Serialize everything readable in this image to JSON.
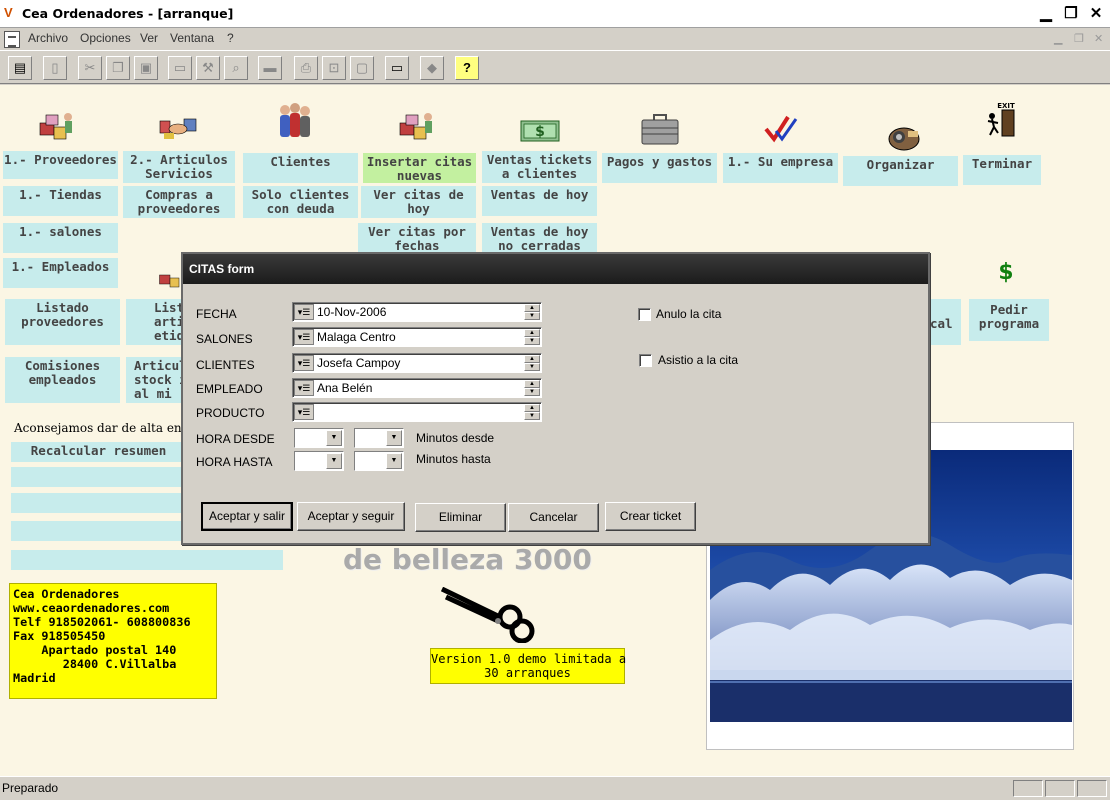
{
  "window": {
    "title": "Cea Ordenadores  - [arranque]",
    "minimize": "▁",
    "restore": "❐",
    "close": "✕"
  },
  "menu": {
    "items": [
      "Archivo",
      "Opciones",
      "Ver",
      "Ventana",
      "?"
    ],
    "mdi_controls": [
      "▁",
      "❐",
      "✕"
    ]
  },
  "toolbar": {
    "buttons": [
      {
        "name": "open-folder-icon",
        "glyph": "▤"
      },
      {
        "name": "new-document-icon",
        "glyph": "▯"
      },
      {
        "name": "cut-icon",
        "glyph": "✂"
      },
      {
        "name": "copy-icon",
        "glyph": "❐"
      },
      {
        "name": "paste-icon",
        "glyph": "▣"
      },
      {
        "name": "window-icon",
        "glyph": "▭"
      },
      {
        "name": "tools-icon",
        "glyph": "⚒"
      },
      {
        "name": "find-icon",
        "glyph": "⌕"
      },
      {
        "name": "eraser-icon",
        "glyph": "▬"
      },
      {
        "name": "print-icon",
        "glyph": "⎙"
      },
      {
        "name": "print-preview-icon",
        "glyph": "⊡"
      },
      {
        "name": "page-setup-icon",
        "glyph": "▢"
      },
      {
        "name": "monitor-icon",
        "glyph": "▭"
      },
      {
        "name": "label-icon",
        "glyph": "◆"
      },
      {
        "name": "help-icon",
        "glyph": "?"
      }
    ]
  },
  "main": {
    "buttons": {
      "proveedores": "1.- Proveedores",
      "articulos_servicios": "2.- Articulos\nServicios",
      "clientes": "Clientes",
      "insertar_citas": "Insertar citas\nnuevas",
      "ventas_tickets": "Ventas tickets\na clientes",
      "pagos_gastos": "Pagos y gastos",
      "su_empresa": "1.- Su empresa",
      "organizar": "Organizar",
      "terminar": "Terminar",
      "tiendas": "1.- Tiendas",
      "compras": "Compras a\nproveedores",
      "solo_clientes_deuda": "Solo clientes\ncon deuda",
      "ver_citas_hoy": "Ver citas de\nhoy",
      "ventas_hoy": "Ventas de hoy",
      "salones": "1.- salones",
      "ver_citas_fechas": "Ver citas por\nfechas",
      "ventas_no_cerradas": "Ventas de hoy\nno cerradas",
      "empleados": "1.- Empleados",
      "listado_proveedores": "Listado\nproveedores",
      "listado_articulos": "List\nartic\netiqu",
      "pedir_programa": "Pedir\nprograma",
      "partial_right": "cal",
      "comisiones": "Comisiones\nempleados",
      "articulos_stock": "Articul\nstock i\nal mi",
      "recalcular": "Recalcular resumen"
    },
    "info_text": "Aconsejamos dar de alta en e",
    "belleza": "de belleza 3000",
    "contact_lines": [
      "Cea Ordenadores",
      "www.ceaordenadores.com",
      "Telf 918502061- 608800836",
      "Fax 918505450",
      "    Apartado postal 140",
      "       28400 C.Villalba",
      "Madrid"
    ],
    "demo_notice": "Version 1.0 demo limitada a\n30 arranques",
    "icons": [
      "boxes-icon",
      "handshake-icon",
      "people-icon",
      "boxes-icon",
      "money-icon",
      "briefcase-icon",
      "checkmark-icon",
      "projector-icon",
      "exit-door-icon",
      "dollar-icon",
      "scissors-icon",
      "landscape-photo"
    ]
  },
  "dialog": {
    "title": "CITAS form",
    "labels": {
      "fecha": "FECHA",
      "salones": "SALONES",
      "clientes": "CLIENTES",
      "empleado": "EMPLEADO",
      "producto": "PRODUCTO",
      "hora_desde": "HORA DESDE",
      "hora_hasta": "HORA HASTA",
      "minutos_desde": "Minutos desde",
      "minutos_hasta": "Minutos hasta"
    },
    "values": {
      "fecha": "10-Nov-2006",
      "salones": "Malaga Centro",
      "clientes": "Josefa Campoy",
      "empleado": "Ana Belén",
      "producto": ""
    },
    "checkboxes": {
      "anulo": "Anulo la cita",
      "asistio": "Asistio a la cita"
    },
    "buttons": {
      "aceptar_salir": "Aceptar y salir",
      "aceptar_seguir": "Aceptar y seguir",
      "eliminar": "Eliminar",
      "cancelar": "Cancelar",
      "crear_ticket": "Crear ticket"
    }
  },
  "status": {
    "text": "Preparado"
  },
  "colors": {
    "button_cyan": "#c7ecec",
    "button_green": "#c3f0a0",
    "client_bg": "#fbf6e4",
    "notice_yellow": "#ffff00",
    "dialog_title": "#1b1b1b"
  }
}
